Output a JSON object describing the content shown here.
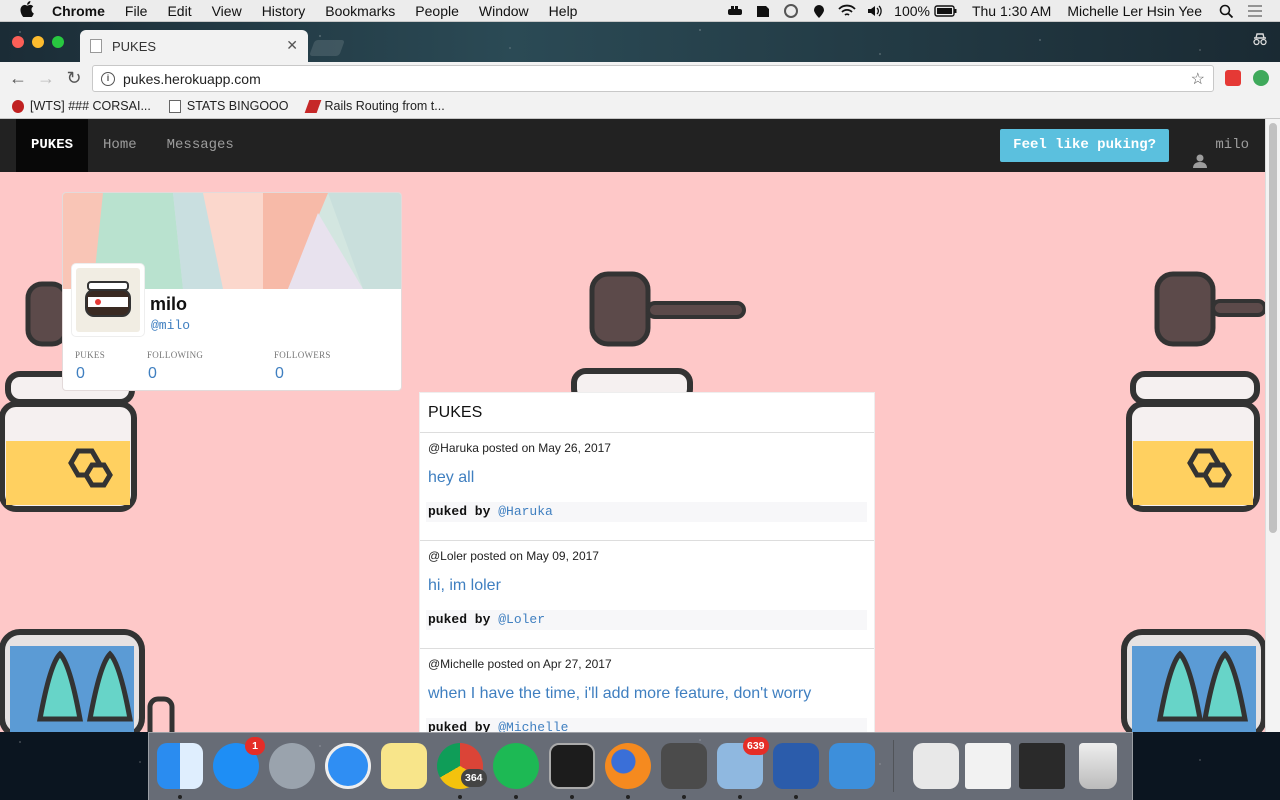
{
  "menubar": {
    "items": [
      "Chrome",
      "File",
      "Edit",
      "View",
      "History",
      "Bookmarks",
      "People",
      "Window",
      "Help"
    ],
    "battery": "100%",
    "clock": "Thu 1:30 AM",
    "user": "Michelle Ler Hsin Yee"
  },
  "browser": {
    "tab_title": "PUKES",
    "url": "pukes.herokuapp.com",
    "bookmarks": [
      "[WTS] ### CORSAI...",
      "STATS BINGOOO",
      "Rails Routing from t..."
    ]
  },
  "site": {
    "brand": "PUKES",
    "nav": [
      "Home",
      "Messages"
    ],
    "cta": "Feel like puking?",
    "current_user": "milo"
  },
  "profile": {
    "name": "milo",
    "handle": "@milo",
    "stats": [
      {
        "label": "PUKES",
        "value": "0"
      },
      {
        "label": "FOLLOWING",
        "value": "0"
      },
      {
        "label": "FOLLOWERS",
        "value": "0"
      }
    ]
  },
  "feed": {
    "title": "PUKES",
    "items": [
      {
        "meta": "@Haruka posted on May 26, 2017",
        "body": "hey all",
        "by_prefix": "puked by ",
        "by_user": "@Haruka"
      },
      {
        "meta": "@Loler posted on May 09, 2017",
        "body": "hi, im loler",
        "by_prefix": "puked by ",
        "by_user": "@Loler"
      },
      {
        "meta": "@Michelle posted on Apr 27, 2017",
        "body": "when I have the time, i'll add more feature, don't worry",
        "by_prefix": "puked by ",
        "by_user": "@Michelle"
      }
    ]
  },
  "dock": {
    "badges": {
      "app_store": "1",
      "chrome": "364",
      "mail": "639"
    },
    "apps": [
      "finder-icon",
      "app-store-icon",
      "launchpad-icon",
      "safari-icon",
      "notes-icon",
      "chrome-icon",
      "spotify-icon",
      "terminal-icon",
      "firefox-icon",
      "sublime-icon",
      "mail-icon",
      "word-icon",
      "wunderlist-icon",
      "preview-icon",
      "finder-window-icon",
      "terminal-window-icon",
      "trash-icon"
    ]
  },
  "colors": {
    "page_bg": "#fec8c8",
    "navbar_bg": "#222222",
    "accent": "#5bc0de",
    "link": "#3f7fc0"
  }
}
